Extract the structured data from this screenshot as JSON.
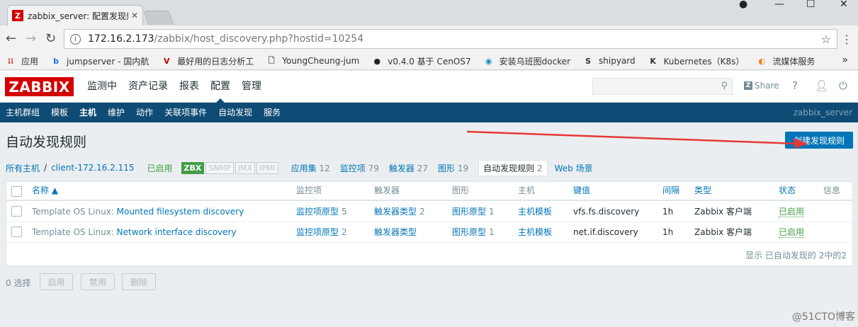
{
  "browser": {
    "tab_title": "zabbix_server: 配置发现规",
    "url_host": "172.16.2.173",
    "url_path": "/zabbix/host_discovery.php?hostid=10254",
    "bookmarks": [
      {
        "label": "应用",
        "icon": "apps-grid-icon",
        "color": "#d93025"
      },
      {
        "label": "jumpserver - 国内航",
        "icon": "bookmark-b-icon",
        "color": "#1a73e8"
      },
      {
        "label": "最好用的日志分析工",
        "icon": "bookmark-v-icon",
        "color": "#c00000"
      },
      {
        "label": "YoungCheung-jum",
        "icon": "page-icon",
        "color": "#555555"
      },
      {
        "label": "v0.4.0 基于 CenOS7",
        "icon": "github-icon",
        "color": "#222222"
      },
      {
        "label": "安装乌班图docker",
        "icon": "bookmark-circle-icon",
        "color": "#1e88c7"
      },
      {
        "label": "shipyard",
        "icon": "bookmark-s-icon",
        "color": "#333333"
      },
      {
        "label": "Kubernetes（K8s）",
        "icon": "bookmark-k-icon",
        "color": "#333333"
      },
      {
        "label": "流媒体服务",
        "icon": "bookmark-flame-icon",
        "color": "#f57c00"
      }
    ]
  },
  "header": {
    "logo": "ZABBIX",
    "main_nav": [
      "监测中",
      "资产记录",
      "报表",
      "配置",
      "管理"
    ],
    "share": "Share",
    "help": "?",
    "sub_nav": [
      "主机群组",
      "模板",
      "主机",
      "维护",
      "动作",
      "关联项事件",
      "自动发现",
      "服务"
    ],
    "server_name": "zabbix_server"
  },
  "page": {
    "title": "自动发现规则",
    "create_button": "创建发现规则"
  },
  "hostline": {
    "all_hosts": "所有主机",
    "separator": "/",
    "host": "client-172.16.2.115",
    "status": "已启用",
    "tags": [
      "ZBX",
      "SNMP",
      "JMX",
      "IPMI"
    ],
    "apps": {
      "label": "应用集",
      "count": "12"
    },
    "items": {
      "label": "监控项",
      "count": "79"
    },
    "triggers": {
      "label": "触发器",
      "count": "27"
    },
    "graphs": {
      "label": "图形",
      "count": "19"
    },
    "discovery": {
      "label": "自动发现规则",
      "count": "2"
    },
    "web": "Web 场景"
  },
  "table": {
    "headers": {
      "name": "名称 ▲",
      "items": "监控项",
      "triggers": "触发器",
      "graphs": "图形",
      "hosts": "主机",
      "key": "键值",
      "interval": "间隔",
      "type": "类型",
      "status": "状态",
      "info": "信息"
    },
    "rows": [
      {
        "template": "Template OS Linux",
        "name": "Mounted filesystem discovery",
        "items": "监控项原型",
        "items_count": "5",
        "triggers": "触发器类型",
        "triggers_count": "2",
        "graphs": "图形原型",
        "graphs_count": "1",
        "hosts": "主机模板",
        "key": "vfs.fs.discovery",
        "interval": "1h",
        "type": "Zabbix 客户端",
        "status": "已启用"
      },
      {
        "template": "Template OS Linux",
        "name": "Network interface discovery",
        "items": "监控项原型",
        "items_count": "2",
        "triggers": "触发器类型",
        "triggers_count": "",
        "graphs": "图形原型",
        "graphs_count": "1",
        "hosts": "主机模板",
        "key": "net.if.discovery",
        "interval": "1h",
        "type": "Zabbix 客户端",
        "status": "已启用"
      }
    ],
    "footer": "显示 已自动发现的 2中的2"
  },
  "actions": {
    "selected": "0 选择",
    "enable": "启用",
    "disable": "禁用",
    "delete": "删除"
  },
  "watermark": "@51CTO博客",
  "colors": {
    "zabbix_red": "#d40000",
    "nav_blue": "#0f4c75",
    "link_blue": "#0275b8",
    "status_green": "#429e47",
    "annotation_arrow": "#e53935"
  }
}
